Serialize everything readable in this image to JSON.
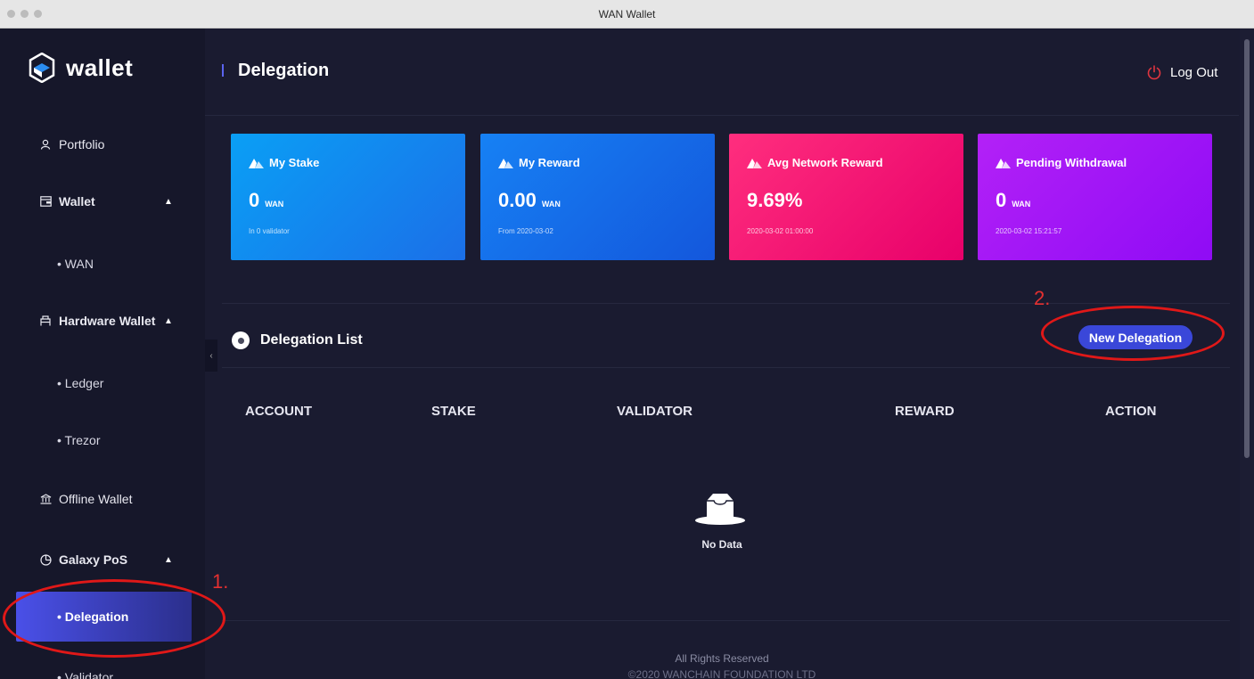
{
  "window": {
    "title": "WAN Wallet"
  },
  "sidebar": {
    "logo_text": "wallet",
    "items": [
      {
        "label": "Portfolio"
      },
      {
        "label": "Wallet"
      },
      {
        "label": "WAN"
      },
      {
        "label": "Hardware Wallet"
      },
      {
        "label": "Ledger"
      },
      {
        "label": "Trezor"
      },
      {
        "label": "Offline Wallet"
      },
      {
        "label": "Galaxy PoS"
      },
      {
        "label": "Delegation"
      },
      {
        "label": "Validator"
      }
    ]
  },
  "header": {
    "title": "Delegation",
    "logout_label": "Log Out"
  },
  "cards": [
    {
      "title": "My Stake",
      "value": "0",
      "unit": "WAN",
      "sub": "In 0 validator",
      "color_from": "#0a9ff5",
      "color_to": "#1b6fe8"
    },
    {
      "title": "My Reward",
      "value": "0.00",
      "unit": "WAN",
      "sub": "From 2020-03-02",
      "color_from": "#1681f4",
      "color_to": "#1457dc"
    },
    {
      "title": "Avg Network Reward",
      "value": "9.69%",
      "unit": "",
      "sub": "2020-03-02 01:00:00",
      "color_from": "#ff2e7e",
      "color_to": "#e8006a"
    },
    {
      "title": "Pending Withdrawal",
      "value": "0",
      "unit": "WAN",
      "sub": "2020-03-02 15:21:57",
      "color_from": "#b321f7",
      "color_to": "#8f0bf5"
    }
  ],
  "list": {
    "title": "Delegation List",
    "new_button": "New Delegation",
    "columns": [
      "ACCOUNT",
      "STAKE",
      "VALIDATOR",
      "REWARD",
      "ACTION"
    ],
    "empty_text": "No Data"
  },
  "footer": {
    "line1": "All Rights Reserved",
    "line2": "©2020 WANCHAIN FOUNDATION LTD"
  },
  "annotations": {
    "step1": "1.",
    "step2": "2."
  },
  "colors": {
    "accent": "#3a47d9",
    "annotation": "#e01818"
  }
}
